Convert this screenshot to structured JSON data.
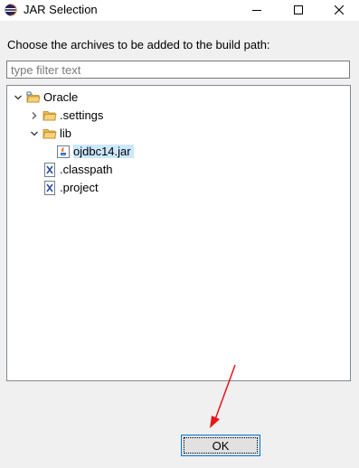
{
  "window": {
    "title": "JAR Selection"
  },
  "dialog": {
    "instruction": "Choose the archives to be added to the build path:",
    "filter_placeholder": "type filter text",
    "ok_label": "OK"
  },
  "tree": {
    "project": "Oracle",
    "settings_folder": ".settings",
    "lib_folder": "lib",
    "jar_file": "ojdbc14.jar",
    "classpath_file": ".classpath",
    "project_file": ".project"
  },
  "colors": {
    "selection": "#cce8ff",
    "annotation_arrow": "#e8141a",
    "folder": "#e8b94a"
  }
}
